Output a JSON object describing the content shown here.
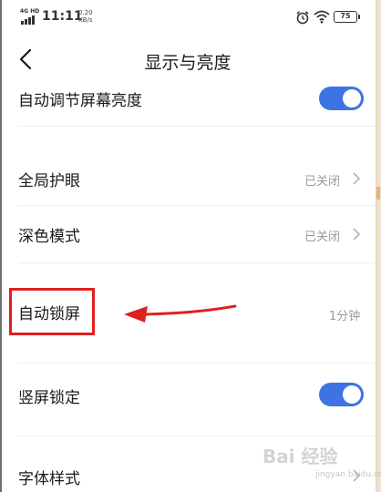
{
  "status_bar": {
    "network": "4G HD",
    "time": "11:11",
    "speed_value": "0.20",
    "speed_unit": "KB/s",
    "battery": "75"
  },
  "header": {
    "title": "显示与亮度"
  },
  "settings": {
    "auto_brightness": {
      "label": "自动调节屏幕亮度",
      "enabled": true
    },
    "eye_protection": {
      "label": "全局护眼",
      "value": "已关闭"
    },
    "dark_mode": {
      "label": "深色模式",
      "value": "已关闭"
    },
    "auto_lock": {
      "label": "自动锁屏",
      "value": "1分钟"
    },
    "portrait_lock": {
      "label": "竖屏锁定",
      "enabled": true
    },
    "font_style": {
      "label": "字体样式"
    }
  },
  "watermark": {
    "brand": "Bai 经验",
    "site": "jingyan.baidu.com"
  },
  "colors": {
    "toggle_on": "#3d73e3",
    "annotation_red": "#e02020",
    "value_gray": "#9a9a9a"
  }
}
